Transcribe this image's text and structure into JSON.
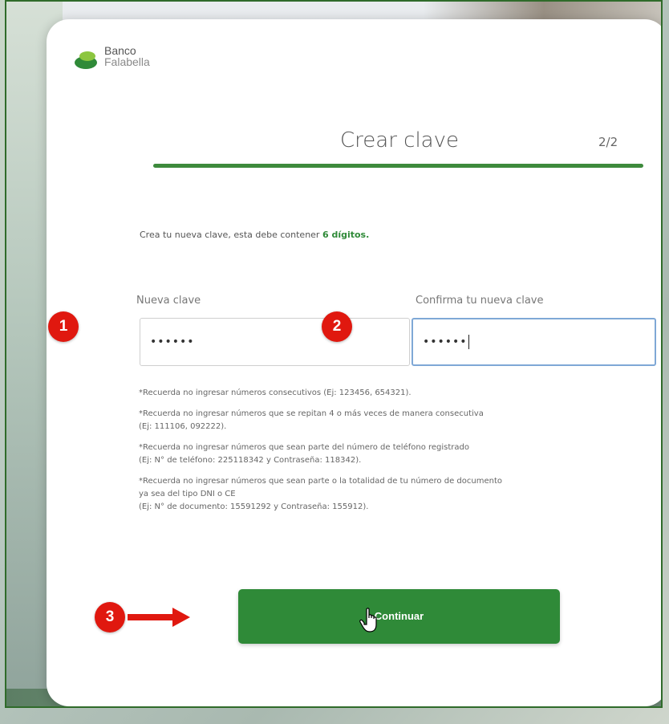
{
  "brand": {
    "line1": "Banco",
    "line2": "Falabella",
    "icon": "banco-falabella-logo"
  },
  "header": {
    "title": "Crear clave",
    "step": "2/2"
  },
  "lead": {
    "text": "Crea tu nueva clave, esta debe contener ",
    "highlight": "6 dígitos."
  },
  "fields": {
    "new_password": {
      "label": "Nueva clave",
      "value": "••••••"
    },
    "confirm_password": {
      "label": "Confirma tu nueva clave",
      "value": "••••••"
    }
  },
  "notes": [
    {
      "lines": [
        "*Recuerda no ingresar números consecutivos (Ej: 123456, 654321)."
      ]
    },
    {
      "lines": [
        "*Recuerda no ingresar números que se repitan 4 o más veces de manera consecutiva",
        "(Ej: 111106, 092222)."
      ]
    },
    {
      "lines": [
        "*Recuerda no ingresar números que sean parte del número de teléfono registrado",
        "(Ej: N° de teléfono: 225118342 y Contraseña: 118342)."
      ]
    },
    {
      "lines": [
        "*Recuerda no ingresar números que sean parte o la totalidad de tu número de documento",
        "ya sea del tipo DNI o CE",
        "(Ej: N° de documento: 15591292 y Contraseña: 155912)."
      ]
    }
  ],
  "button": {
    "label": "Continuar"
  },
  "annotations": {
    "step1": "1",
    "step2": "2",
    "step3": "3"
  },
  "colors": {
    "brand_green": "#2f8a38",
    "annotation_red": "#e0180f",
    "focus_blue": "#7fa8d6"
  }
}
